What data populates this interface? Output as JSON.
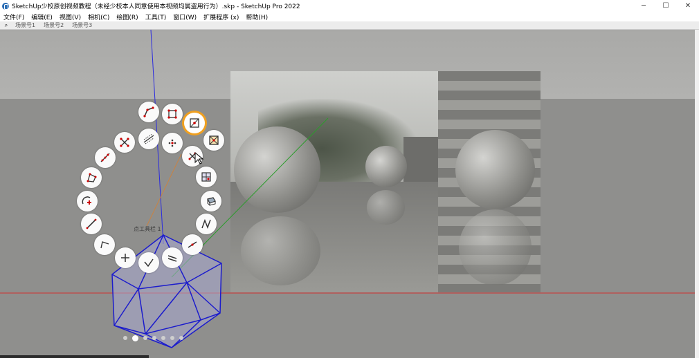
{
  "window": {
    "title": "SketchUp少校原创视频教程（未经少校本人同意使用本视频均属盗用行为）.skp - SketchUp Pro 2022",
    "minimize": "─",
    "maximize": "☐",
    "close": "✕"
  },
  "menu": [
    "文件(F)",
    "编辑(E)",
    "视图(V)",
    "相机(C)",
    "绘图(R)",
    "工具(T)",
    "窗口(W)",
    "扩展程序 (x)",
    "帮助(H)"
  ],
  "scenes": [
    "场景号1",
    "场景号2",
    "场景号3"
  ],
  "pie_menu": {
    "center_label": "点工具栏 1",
    "items": [
      "polyline-tool",
      "rectangle-points-tool",
      "bounding-box-tool",
      "box-cross-tool",
      "scatter-points-tool",
      "grid-points-tool",
      "offset-points-tool",
      "cross-points-tool",
      "line-points-tool",
      "polygon-points-tool",
      "arc-add-tool",
      "line-tool",
      "bracket-tool",
      "plus-tool",
      "check-tool",
      "parallel-lines-tool",
      "divide-line-tool",
      "zigzag-tool",
      "box-3d-tool"
    ],
    "selected": "bounding-box-tool"
  },
  "page_dots": [
    false,
    true,
    false,
    false,
    false,
    false,
    false
  ],
  "colors": {
    "selection": "#f0a020",
    "model_edge": "#1c1ccc",
    "axis_blue": "#2a2ae0",
    "axis_red": "#d03030",
    "axis_green": "#2c9c2c"
  }
}
